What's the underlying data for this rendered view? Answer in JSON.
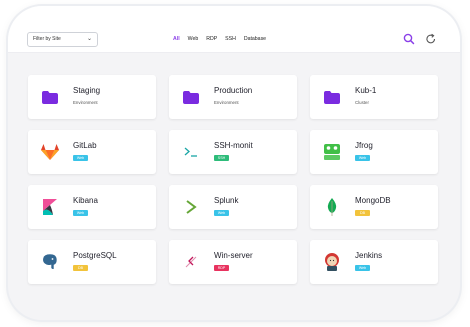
{
  "filter": {
    "label": "Filter by Site"
  },
  "tabs": [
    {
      "label": "All"
    },
    {
      "label": "Web"
    },
    {
      "label": "RDP"
    },
    {
      "label": "SSH"
    },
    {
      "label": "Database"
    }
  ],
  "cards": [
    {
      "title": "Staging",
      "subtitle": "Environment"
    },
    {
      "title": "Production",
      "subtitle": "Environment"
    },
    {
      "title": "Kub-1",
      "subtitle": "Cluster"
    },
    {
      "title": "GitLab",
      "badge": "Web",
      "badge_color": "#39c3e8"
    },
    {
      "title": "SSH-monit",
      "badge": "SSH",
      "badge_color": "#2ebc7a"
    },
    {
      "title": "Jfrog",
      "badge": "Web",
      "badge_color": "#39c3e8"
    },
    {
      "title": "Kibana",
      "badge": "Web",
      "badge_color": "#39c3e8"
    },
    {
      "title": "Splunk",
      "badge": "Web",
      "badge_color": "#39c3e8"
    },
    {
      "title": "MongoDB",
      "badge": "DB",
      "badge_color": "#f2c33b"
    },
    {
      "title": "PostgreSQL",
      "badge": "DB",
      "badge_color": "#f2c33b"
    },
    {
      "title": "Win-server",
      "badge": "RDP",
      "badge_color": "#e8335f"
    },
    {
      "title": "Jenkins",
      "badge": "Web",
      "badge_color": "#39c3e8"
    }
  ],
  "colors": {
    "accent": "#8a3fe8",
    "folder": "#7a2be0"
  }
}
